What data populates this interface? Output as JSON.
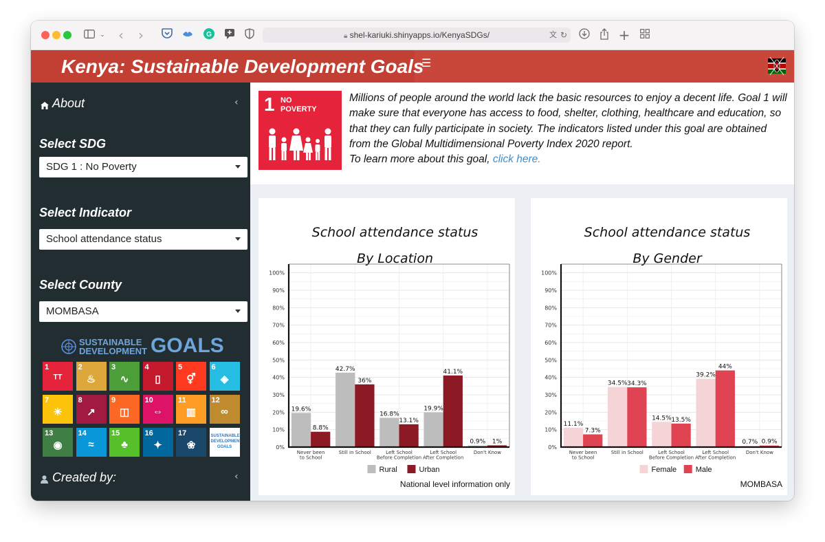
{
  "browser": {
    "url": "shel-kariuki.shinyapps.io/KenyaSDGs/",
    "toolbar_icons": [
      "sidebar-icon",
      "chevron-down-icon",
      "back-icon",
      "forward-icon",
      "pocket-icon",
      "bird-icon",
      "grammarly-icon",
      "chat-icon",
      "shield-icon",
      "translate-icon",
      "reload-icon",
      "download-icon",
      "share-icon",
      "new-tab-icon",
      "tab-overview-icon"
    ]
  },
  "header": {
    "title": "Kenya: Sustainable Development Goals",
    "menu_icon": "hamburger-icon",
    "flag_icon": "kenya-flag-icon",
    "accent_color": "#c9463b"
  },
  "sidebar": {
    "about_label": "About",
    "sdg_label": "Select SDG",
    "sdg_value": "SDG 1 : No Poverty",
    "indicator_label": "Select Indicator",
    "indicator_value": "School attendance status",
    "county_label": "Select County",
    "county_value": "MOMBASA",
    "sdg_logo_line1": "SUSTAINABLE",
    "sdg_logo_line2": "DEVELOPMENT",
    "sdg_logo_goals": "GOALS",
    "created_by_label": "Created by:",
    "background_color": "#222d32",
    "tiles": [
      {
        "n": "1",
        "t": "NO POVERTY",
        "c": "#e5243b"
      },
      {
        "n": "2",
        "t": "ZERO HUNGER",
        "c": "#dda63a"
      },
      {
        "n": "3",
        "t": "GOOD HEALTH AND WELL-BEING",
        "c": "#4c9f38"
      },
      {
        "n": "4",
        "t": "QUALITY EDUCATION",
        "c": "#c5192d"
      },
      {
        "n": "5",
        "t": "GENDER EQUALITY",
        "c": "#ff3a21"
      },
      {
        "n": "6",
        "t": "CLEAN WATER AND SANITATION",
        "c": "#26bde2"
      },
      {
        "n": "7",
        "t": "AFFORDABLE AND CLEAN ENERGY",
        "c": "#fcc30b"
      },
      {
        "n": "8",
        "t": "DECENT WORK AND ECONOMIC GROWTH",
        "c": "#a21942"
      },
      {
        "n": "9",
        "t": "INDUSTRY, INNOVATION AND INFRASTRUCTURE",
        "c": "#fd6925"
      },
      {
        "n": "10",
        "t": "REDUCED INEQUALITIES",
        "c": "#dd1367"
      },
      {
        "n": "11",
        "t": "SUSTAINABLE CITIES AND COMMUNITIES",
        "c": "#fd9d24"
      },
      {
        "n": "12",
        "t": "RESPONSIBLE CONSUMPTION AND PRODUCTION",
        "c": "#bf8b2e"
      },
      {
        "n": "13",
        "t": "CLIMATE ACTION",
        "c": "#3f7e44"
      },
      {
        "n": "14",
        "t": "LIFE BELOW WATER",
        "c": "#0a97d9"
      },
      {
        "n": "15",
        "t": "LIFE ON LAND",
        "c": "#56c02b"
      },
      {
        "n": "16",
        "t": "PEACE, JUSTICE AND STRONG INSTITUTIONS",
        "c": "#00689d"
      },
      {
        "n": "17",
        "t": "PARTNERSHIPS FOR THE GOALS",
        "c": "#19486a"
      },
      {
        "n": "",
        "t": "SUSTAINABLE DEVELOPMENT GOALS",
        "c": "#ffffff"
      }
    ]
  },
  "goal": {
    "number": "1",
    "name_line1": "NO",
    "name_line2": "POVERTY",
    "description": "Millions of people around the world lack the basic resources to enjoy a decent life. Goal 1 will make sure that everyone has access to food, shelter, clothing, healthcare and education, so that they can fully participate in society. The indicators listed under this goal are obtained from the Global Multidimensional Poverty Index 2020 report.",
    "learn_more_prefix": "To learn more about this goal,",
    "learn_more_link": "click here."
  },
  "chart_data": [
    {
      "type": "bar",
      "title": "School attendance status",
      "subtitle": "By Location",
      "categories": [
        "Never been to School",
        "Still in School",
        "Left School Before Completion",
        "Left School After Completion",
        "Don't Know"
      ],
      "category_lines": [
        [
          "Never been",
          "to School"
        ],
        [
          "Still in School"
        ],
        [
          "Left School",
          "Before Completion"
        ],
        [
          "Left School",
          "After Completion"
        ],
        [
          "Don't Know"
        ]
      ],
      "series": [
        {
          "name": "Rural",
          "values": [
            19.6,
            42.7,
            16.8,
            19.9,
            0.9
          ],
          "labels": [
            "19.6%",
            "42.7%",
            "16.8%",
            "19.9%",
            "0.9%"
          ],
          "color": "#bdbdbd"
        },
        {
          "name": "Urban",
          "values": [
            8.8,
            36,
            13.1,
            41.1,
            1
          ],
          "labels": [
            "8.8%",
            "36%",
            "13.1%",
            "41.1%",
            "1%"
          ],
          "color": "#8b1a24"
        }
      ],
      "ylim": [
        0,
        100
      ],
      "y_ticks": [
        "0%",
        "10%",
        "20%",
        "30%",
        "40%",
        "50%",
        "60%",
        "70%",
        "80%",
        "90%",
        "100%"
      ],
      "grid": true,
      "legend": "bottom",
      "caption": "National level information only"
    },
    {
      "type": "bar",
      "title": "School attendance status",
      "subtitle": "By Gender",
      "categories": [
        "Never been to School",
        "Still in School",
        "Left School Before Completion",
        "Left School After Completion",
        "Don't Know"
      ],
      "category_lines": [
        [
          "Never been",
          "to School"
        ],
        [
          "Still in School"
        ],
        [
          "Left School",
          "Before Completion"
        ],
        [
          "Left School",
          "After Completion"
        ],
        [
          "Don't Know"
        ]
      ],
      "series": [
        {
          "name": "Female",
          "values": [
            11.1,
            34.5,
            14.5,
            39.2,
            0.7
          ],
          "labels": [
            "11.1%",
            "34.5%",
            "14.5%",
            "39.2%",
            "0.7%"
          ],
          "color": "#f4d4d7"
        },
        {
          "name": "Male",
          "values": [
            7.3,
            34.3,
            13.5,
            44,
            0.9
          ],
          "labels": [
            "7.3%",
            "34.3%",
            "13.5%",
            "44%",
            "0.9%"
          ],
          "color": "#e04453"
        }
      ],
      "ylim": [
        0,
        100
      ],
      "y_ticks": [
        "0%",
        "10%",
        "20%",
        "30%",
        "40%",
        "50%",
        "60%",
        "70%",
        "80%",
        "90%",
        "100%"
      ],
      "grid": true,
      "legend": "bottom",
      "caption": "MOMBASA"
    }
  ]
}
